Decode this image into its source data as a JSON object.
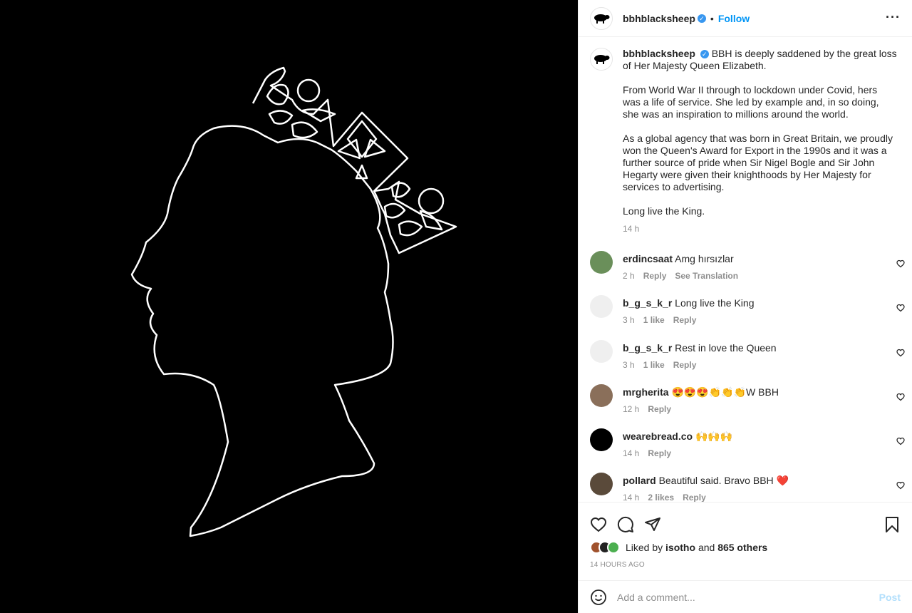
{
  "post": {
    "username": "bbhblacksheep",
    "follow_label": "Follow",
    "separator": "•",
    "more_label": "···"
  },
  "caption": {
    "username": "bbhblacksheep",
    "first_line": "BBH is deeply saddened by the great loss of Her Majesty Queen Elizabeth.",
    "paragraphs": [
      "From World War II through to lockdown under Covid, hers was a life of service. She led by example and, in so doing, she was an inspiration to millions around the world.",
      "As a global agency that was born in Great Britain, we proudly won the Queen's Award for Export in the 1990s and it was a further source of pride when Sir Nigel Bogle and Sir John Hegarty were given their knighthoods by Her Majesty for services to advertising.",
      "Long live the King."
    ],
    "time": "14 h"
  },
  "comments": [
    {
      "user": "erdincsaat",
      "text": "Amg hırsızlar",
      "time": "2 h",
      "likes": "",
      "reply": "Reply",
      "extra": "See Translation",
      "avatar_color": "#6a8f5a"
    },
    {
      "user": "b_g_s_k_r",
      "text": "Long live the King",
      "time": "3 h",
      "likes": "1 like",
      "reply": "Reply",
      "extra": "",
      "avatar_color": "#efefef"
    },
    {
      "user": "b_g_s_k_r",
      "text": "Rest in love the Queen",
      "time": "3 h",
      "likes": "1 like",
      "reply": "Reply",
      "extra": "",
      "avatar_color": "#efefef"
    },
    {
      "user": "mrgherita",
      "text": "😍😍😍👏👏👏W BBH",
      "time": "12 h",
      "likes": "",
      "reply": "Reply",
      "extra": "",
      "avatar_color": "#8a6f5a"
    },
    {
      "user": "wearebread.co",
      "text": "🙌🙌🙌",
      "time": "14 h",
      "likes": "",
      "reply": "Reply",
      "extra": "",
      "avatar_color": "#000000"
    },
    {
      "user": "pollard",
      "text": "Beautiful said. Bravo BBH ❤️",
      "time": "14 h",
      "likes": "2 likes",
      "reply": "Reply",
      "extra": "",
      "avatar_color": "#5a4a3a"
    }
  ],
  "likes": {
    "prefix": "Liked by",
    "user": "isotho",
    "middle": "and",
    "others": "865 others"
  },
  "timestamp": "14 HOURS AGO",
  "add_comment": {
    "placeholder": "Add a comment...",
    "post_label": "Post"
  },
  "icons": {
    "verified": "verified-badge-icon",
    "heart": "heart-icon",
    "comment": "comment-icon",
    "share": "share-icon",
    "bookmark": "bookmark-icon",
    "emoji": "emoji-icon"
  },
  "colors": {
    "accent": "#0095f6",
    "post_disabled": "#b2dffc",
    "muted": "#8e8e8e"
  }
}
